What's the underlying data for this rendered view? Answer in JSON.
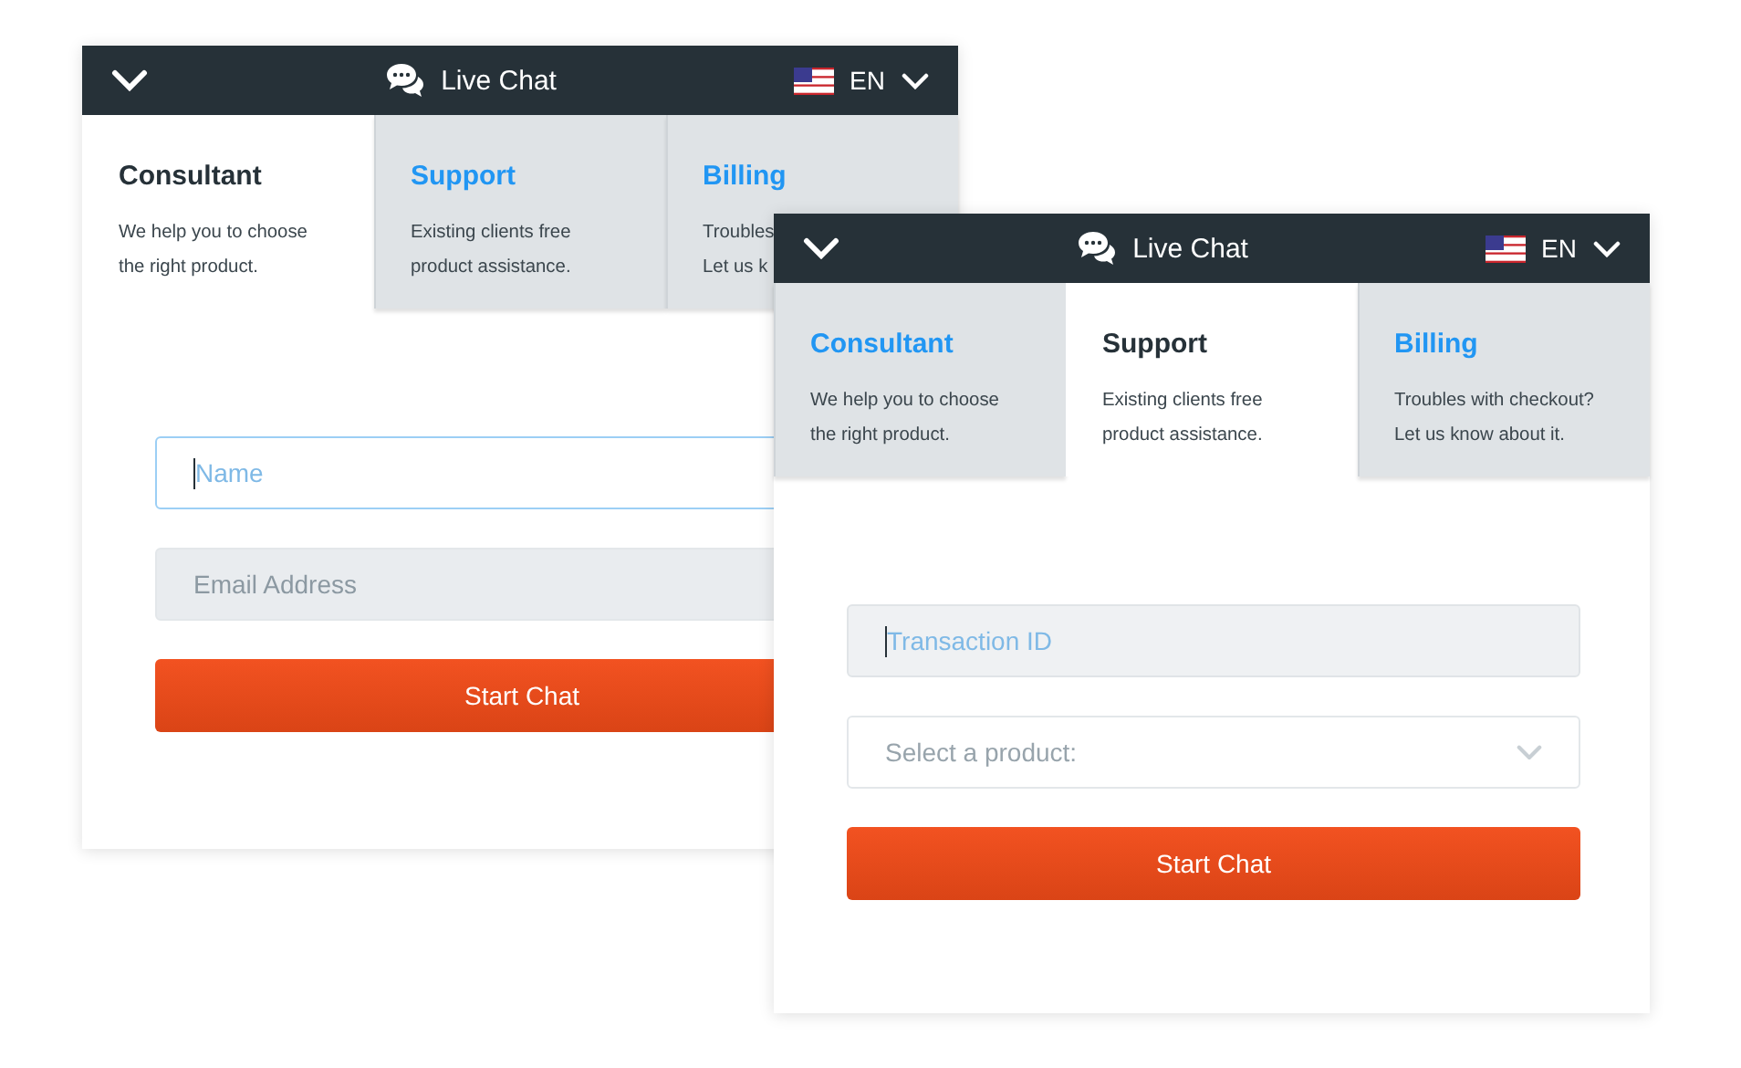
{
  "windows": [
    {
      "header": {
        "title": "Live Chat",
        "language": "EN"
      },
      "tabs": [
        {
          "label": "Consultant",
          "description": [
            "We help you to choose",
            "the right product."
          ],
          "selected": true
        },
        {
          "label": "Support",
          "description": [
            "Existing clients free",
            "product assistance."
          ],
          "selected": false
        },
        {
          "label": "Billing",
          "description": [
            "Troubles",
            "Let us k"
          ],
          "selected": false
        }
      ],
      "fields": [
        {
          "kind": "input",
          "placeholder": "Name",
          "focused": true
        },
        {
          "kind": "input",
          "placeholder": "Email Address",
          "focused": false
        }
      ],
      "button": "Start Chat"
    },
    {
      "header": {
        "title": "Live Chat",
        "language": "EN"
      },
      "tabs": [
        {
          "label": "Consultant",
          "description": [
            "We help you to choose",
            "the right product."
          ],
          "selected": false
        },
        {
          "label": "Support",
          "description": [
            "Existing clients free",
            "product assistance."
          ],
          "selected": true
        },
        {
          "label": "Billing",
          "description": [
            "Troubles with checkout?",
            "Let us know about it."
          ],
          "selected": false
        }
      ],
      "fields": [
        {
          "kind": "input",
          "placeholder": "Transaction ID",
          "focused": true
        },
        {
          "kind": "select",
          "placeholder": "Select a product:",
          "focused": false
        }
      ],
      "button": "Start Chat"
    }
  ]
}
